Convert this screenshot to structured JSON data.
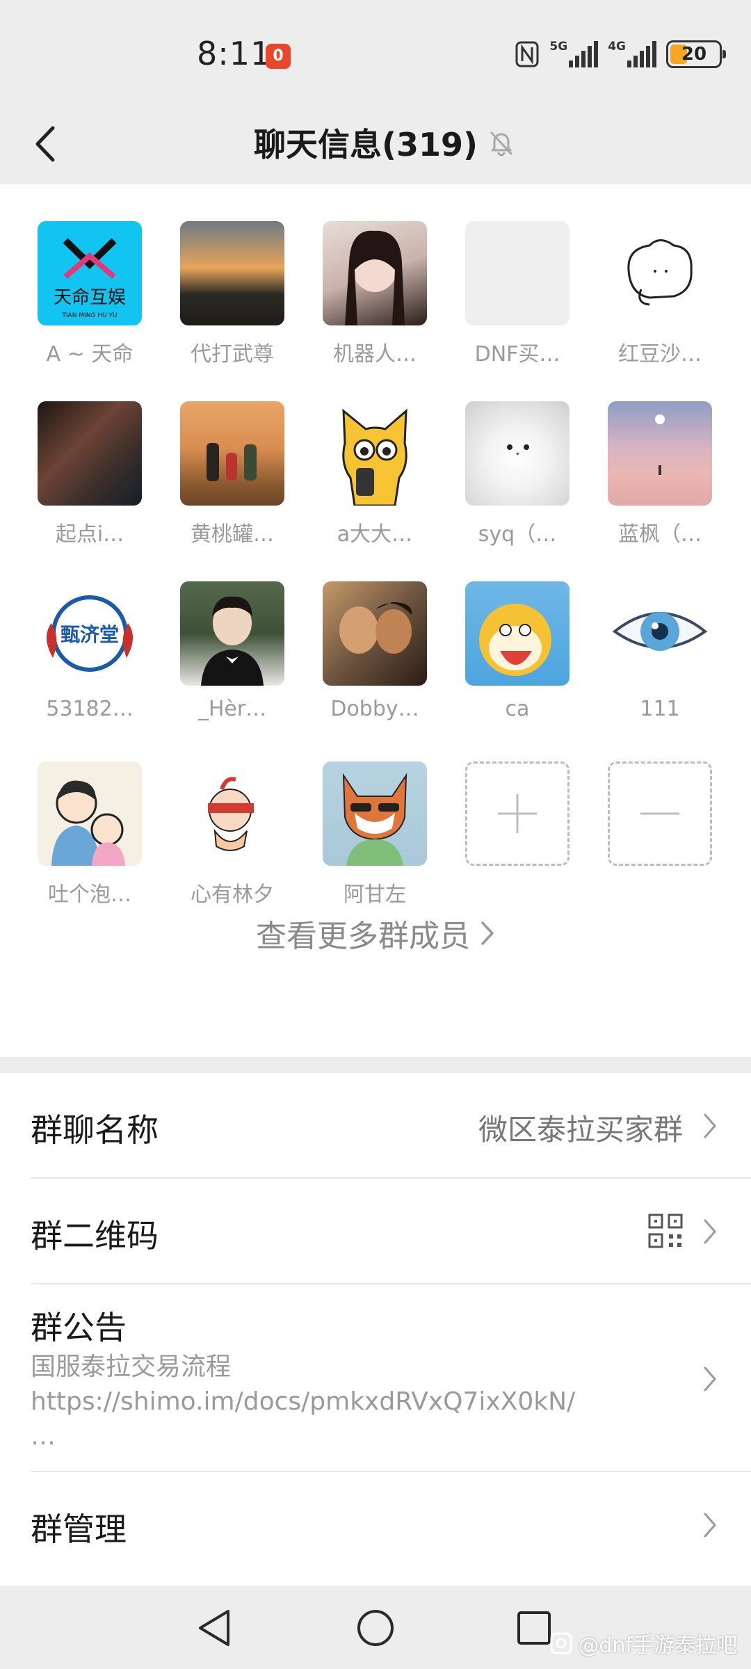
{
  "status_bar": {
    "time": "8:11",
    "notification_badge": "0",
    "network_1": "5G",
    "network_2": "4G",
    "battery": "20"
  },
  "header": {
    "title": "聊天信息(319)",
    "back_icon": "chevron-left-icon",
    "muted_icon": "bell-off-icon"
  },
  "members": [
    {
      "name": "A ~ 天命",
      "color": "#12c4f0"
    },
    {
      "name": "代打武尊",
      "color": "#4a4236"
    },
    {
      "name": "机器人…",
      "color": "#c9b3ab"
    },
    {
      "name": "DNF买…",
      "color": "#efefef"
    },
    {
      "name": "红豆沙…",
      "color": "#ffffff"
    },
    {
      "name": "起点i…",
      "color": "#3a2d2a"
    },
    {
      "name": "黄桃罐…",
      "color": "#d98e52"
    },
    {
      "name": "a大大…",
      "color": "#ffffff"
    },
    {
      "name": "syq（…",
      "color": "#e7e7e7"
    },
    {
      "name": "蓝枫（…",
      "color": "#e6b7b5"
    },
    {
      "name": "53182…",
      "color": "#ffffff"
    },
    {
      "name": "_Hèr…",
      "color": "#3f5038"
    },
    {
      "name": "Dobby…",
      "color": "#6e5540"
    },
    {
      "name": "ca",
      "color": "#4da4de"
    },
    {
      "name": "111",
      "color": "#ffffff"
    },
    {
      "name": "吐个泡…",
      "color": "#f4f0e3"
    },
    {
      "name": "心有林夕",
      "color": "#ffffff"
    },
    {
      "name": "阿甘左",
      "color": "#a9c8d8"
    }
  ],
  "add_member_icon": "plus-icon",
  "remove_member_icon": "minus-icon",
  "more_members_label": "查看更多群成员",
  "avatar_logo_text": "天命互娱",
  "avatar_logo_subtext": "TIAN MING HU YU",
  "avatar_seal_text": "甄济堂",
  "settings": {
    "group_name_label": "群聊名称",
    "group_name_value": "微区泰拉买家群",
    "qr_label": "群二维码",
    "qr_icon": "qr-code-icon",
    "announcement_label": "群公告",
    "announcement_line1": "国服泰拉交易流程",
    "announcement_line2": "https://shimo.im/docs/pmkxdRVxQ7ixX0kN/",
    "announcement_line3": "…",
    "manage_label": "群管理"
  },
  "nav": {
    "back_icon": "triangle-back-icon",
    "home_icon": "circle-home-icon",
    "recents_icon": "square-recents-icon"
  },
  "watermark": "@dnf手游泰拉吧",
  "colors": {
    "background": "#ededed",
    "panel": "#ffffff",
    "battery": "#f5a623",
    "badge": "#e8472a"
  }
}
